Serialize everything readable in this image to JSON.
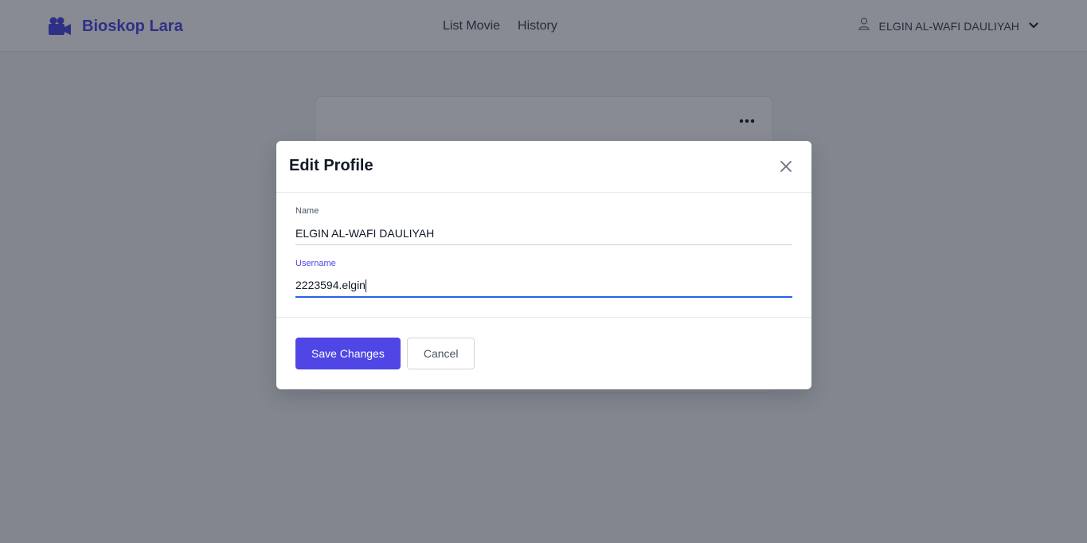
{
  "app": {
    "brand_name": "Bioskop Lara",
    "brand_icon": "video-camera-icon",
    "accent_color": "#4f46e5"
  },
  "nav": {
    "links": [
      {
        "label": "List Movie"
      },
      {
        "label": "History"
      }
    ]
  },
  "user_menu": {
    "name": "ELGIN AL-WAFI DAULIYAH",
    "icon": "user-icon",
    "dropdown_icon": "chevron-down-icon"
  },
  "background_card": {
    "menu_icon": "more-horizontal-icon"
  },
  "modal": {
    "title": "Edit Profile",
    "close_icon": "close-icon",
    "fields": {
      "name": {
        "label": "Name",
        "value": "ELGIN AL-WAFI DAULIYAH"
      },
      "username": {
        "label": "Username",
        "value": "2223594.elgin"
      }
    },
    "buttons": {
      "save_label": "Save Changes",
      "cancel_label": "Cancel"
    }
  }
}
